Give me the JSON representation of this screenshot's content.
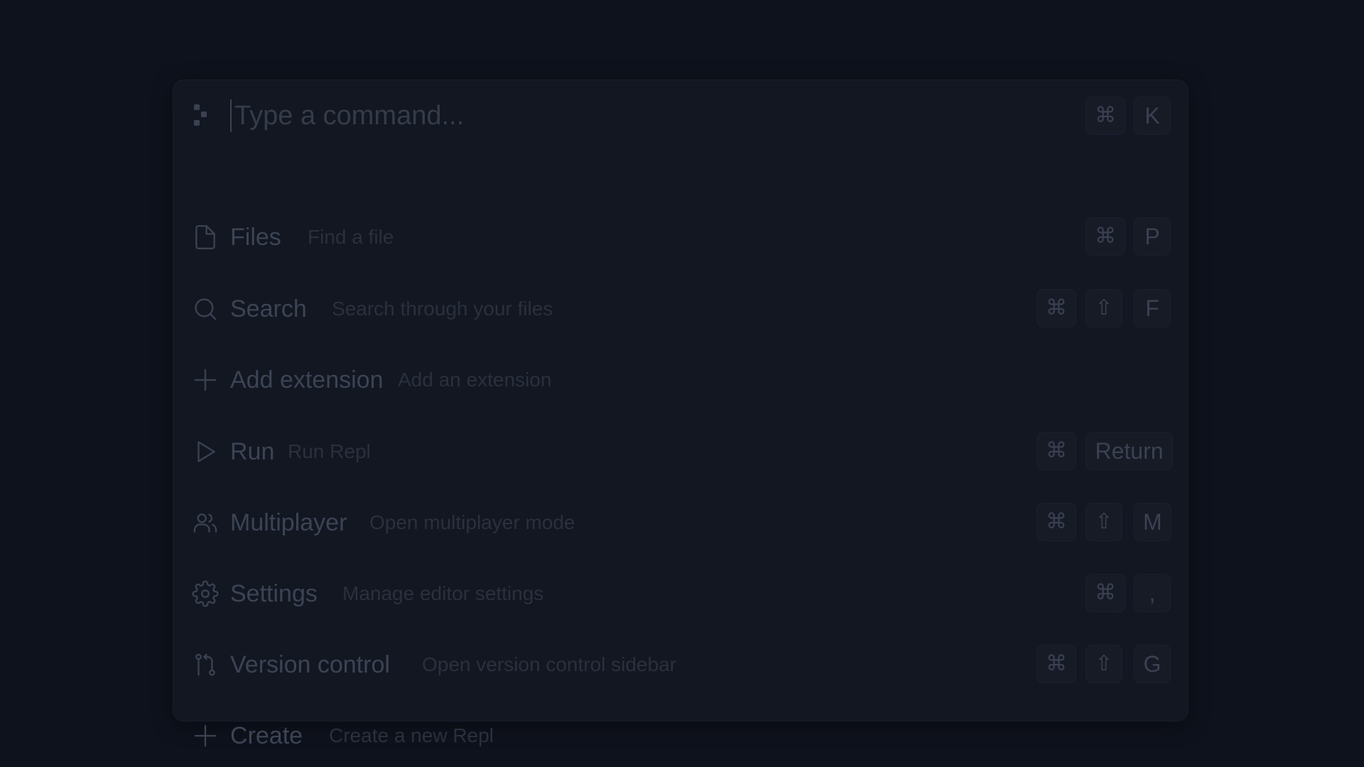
{
  "palette": {
    "placeholder": "Type a command...",
    "open_shortcut": [
      "⌘",
      "K"
    ]
  },
  "items": [
    {
      "label": "Files",
      "description": "Find a file",
      "icon": "file-icon",
      "shortcut": [
        "⌘",
        "P"
      ]
    },
    {
      "label": "Search",
      "description": "Search through your files",
      "icon": "search-icon",
      "shortcut": [
        "⌘",
        "⇧",
        "F"
      ]
    },
    {
      "label": "Add extension",
      "description": "Add an extension",
      "icon": "plus-icon",
      "shortcut": []
    },
    {
      "label": "Run",
      "description": "Run Repl",
      "icon": "play-icon",
      "shortcut": [
        "⌘",
        "Return"
      ]
    },
    {
      "label": "Multiplayer",
      "description": "Open multiplayer mode",
      "icon": "users-icon",
      "shortcut": [
        "⌘",
        "⇧",
        "M"
      ]
    },
    {
      "label": "Settings",
      "description": "Manage editor settings",
      "icon": "gear-icon",
      "shortcut": [
        "⌘",
        ","
      ]
    },
    {
      "label": "Version control",
      "description": "Open version control sidebar",
      "icon": "git-branch-icon",
      "shortcut": [
        "⌘",
        "⇧",
        "G"
      ]
    },
    {
      "label": "Create",
      "description": "Create a new Repl",
      "icon": "plus-icon",
      "shortcut": []
    }
  ]
}
